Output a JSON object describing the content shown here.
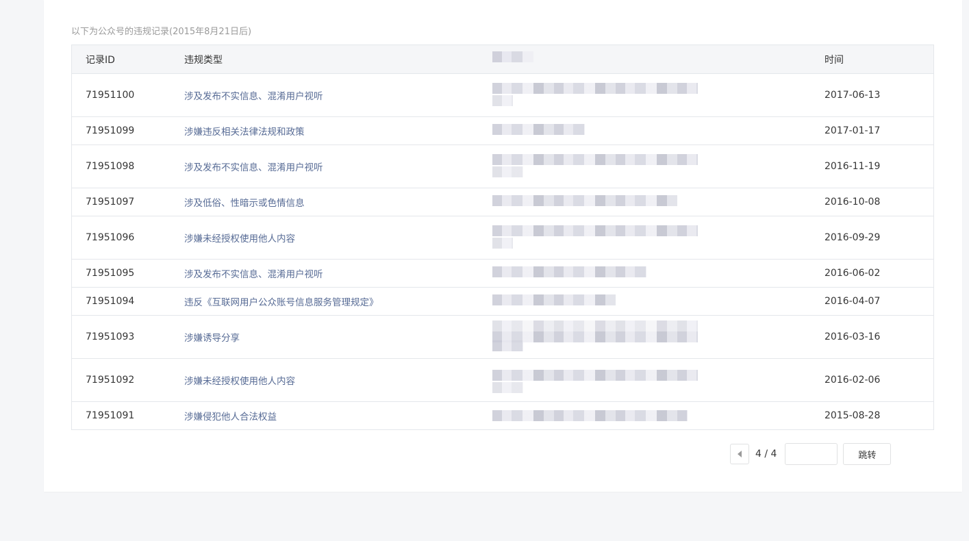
{
  "intro_text": "以下为公众号的违规记录(2015年8月21日后)",
  "table": {
    "headers": {
      "id": "记录ID",
      "type": "违规类型",
      "time": "时间"
    },
    "rows": [
      {
        "id": "71951100",
        "type": "涉及发布不实信息、混淆用户视听",
        "time": "2017-06-13"
      },
      {
        "id": "71951099",
        "type": "涉嫌违反相关法律法规和政策",
        "time": "2017-01-17"
      },
      {
        "id": "71951098",
        "type": "涉及发布不实信息、混淆用户视听",
        "time": "2016-11-19"
      },
      {
        "id": "71951097",
        "type": "涉及低俗、性暗示或色情信息",
        "time": "2016-10-08"
      },
      {
        "id": "71951096",
        "type": "涉嫌未经授权使用他人内容",
        "time": "2016-09-29"
      },
      {
        "id": "71951095",
        "type": "涉及发布不实信息、混淆用户视听",
        "time": "2016-06-02"
      },
      {
        "id": "71951094",
        "type": "违反《互联网用户公众账号信息服务管理规定》",
        "time": "2016-04-07"
      },
      {
        "id": "71951093",
        "type": "涉嫌诱导分享",
        "time": "2016-03-16"
      },
      {
        "id": "71951092",
        "type": "涉嫌未经授权使用他人内容",
        "time": "2016-02-06"
      },
      {
        "id": "71951091",
        "type": "涉嫌侵犯他人合法权益",
        "time": "2015-08-28"
      }
    ]
  },
  "pagination": {
    "page_info": "4 / 4",
    "jump_input_value": "",
    "jump_button_label": "跳转",
    "prev_icon": "caret-left-icon"
  }
}
